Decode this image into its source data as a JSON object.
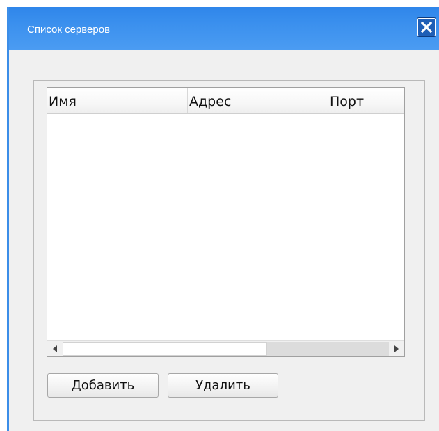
{
  "window": {
    "title": "Список серверов",
    "close_icon": "close-icon"
  },
  "server_table": {
    "columns": [
      "Имя",
      "Адрес",
      "Порт"
    ],
    "rows": []
  },
  "buttons": {
    "add_label": "Добавить",
    "delete_label": "Удалить"
  },
  "colors": {
    "titlebar": "#3b90ee",
    "window_background": "#f0f0f0"
  }
}
